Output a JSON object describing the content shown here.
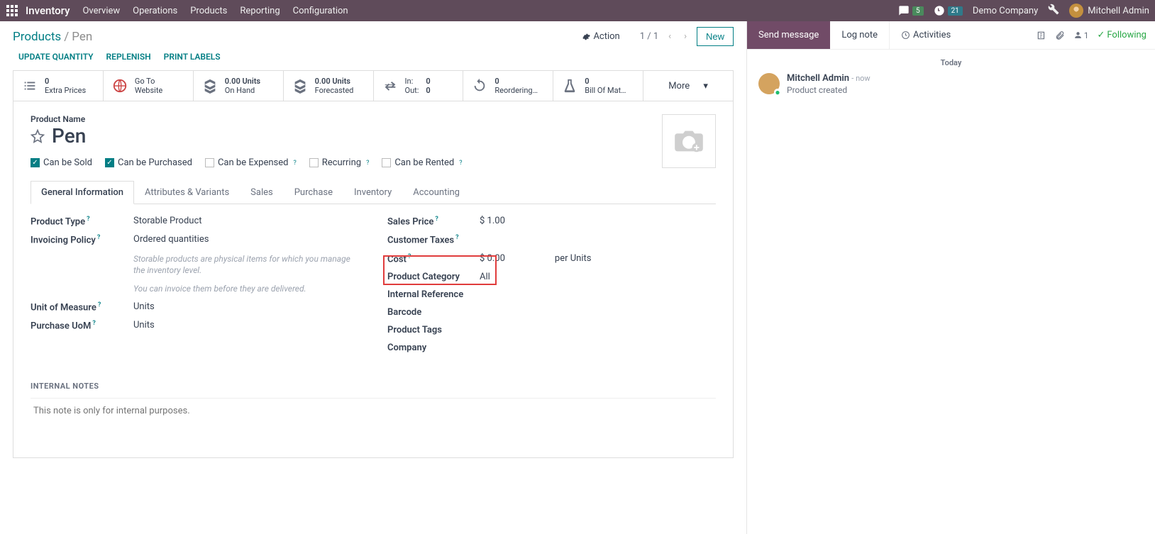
{
  "topbar": {
    "brand": "Inventory",
    "nav": [
      "Overview",
      "Operations",
      "Products",
      "Reporting",
      "Configuration"
    ],
    "msg_badge": "5",
    "clock_badge": "21",
    "company": "Demo Company",
    "user": "Mitchell Admin"
  },
  "breadcrumb": {
    "parent": "Products",
    "current": "Pen"
  },
  "header": {
    "action": "Action",
    "pager": "1 / 1",
    "new": "New"
  },
  "subactions": {
    "update_qty": "UPDATE QUANTITY",
    "replenish": "REPLENISH",
    "print_labels": "PRINT LABELS"
  },
  "stats": {
    "extra_prices": {
      "v": "0",
      "l": "Extra Prices"
    },
    "website": {
      "v": "Go To",
      "l": "Website"
    },
    "onhand": {
      "v": "0.00 Units",
      "l": "On Hand"
    },
    "forecast": {
      "v": "0.00 Units",
      "l": "Forecasted"
    },
    "inout": {
      "in_l": "In:",
      "in_v": "0",
      "out_l": "Out:",
      "out_v": "0"
    },
    "reorder": {
      "v": "0",
      "l": "Reordering…"
    },
    "bom": {
      "v": "0",
      "l": "Bill Of Mat…"
    },
    "more": "More"
  },
  "form": {
    "name_label": "Product Name",
    "name": "Pen",
    "checks": {
      "sold": "Can be Sold",
      "purchased": "Can be Purchased",
      "expensed": "Can be Expensed",
      "recurring": "Recurring",
      "rented": "Can be Rented"
    },
    "tabs": [
      "General Information",
      "Attributes & Variants",
      "Sales",
      "Purchase",
      "Inventory",
      "Accounting"
    ],
    "labels": {
      "product_type": "Product Type",
      "invoicing_policy": "Invoicing Policy",
      "uom": "Unit of Measure",
      "purchase_uom": "Purchase UoM",
      "sales_price": "Sales Price",
      "customer_taxes": "Customer Taxes",
      "cost": "Cost",
      "product_category": "Product Category",
      "internal_ref": "Internal Reference",
      "barcode": "Barcode",
      "product_tags": "Product Tags",
      "company": "Company"
    },
    "values": {
      "product_type": "Storable Product",
      "invoicing_policy": "Ordered quantities",
      "uom": "Units",
      "purchase_uom": "Units",
      "sales_price": "$ 1.00",
      "cost": "$ 0.00",
      "cost_per": "per Units",
      "product_category": "All"
    },
    "hints": {
      "storable": "Storable products are physical items for which you manage the inventory level.",
      "invoice": "You can invoice them before they are delivered."
    },
    "internal_notes_heading": "INTERNAL NOTES",
    "internal_notes_placeholder": "This note is only for internal purposes."
  },
  "side": {
    "send": "Send message",
    "lognote": "Log note",
    "activities": "Activities",
    "follow_count": "1",
    "following": "Following",
    "today": "Today",
    "author": "Mitchell Admin",
    "when": "now",
    "body": "Product created"
  }
}
